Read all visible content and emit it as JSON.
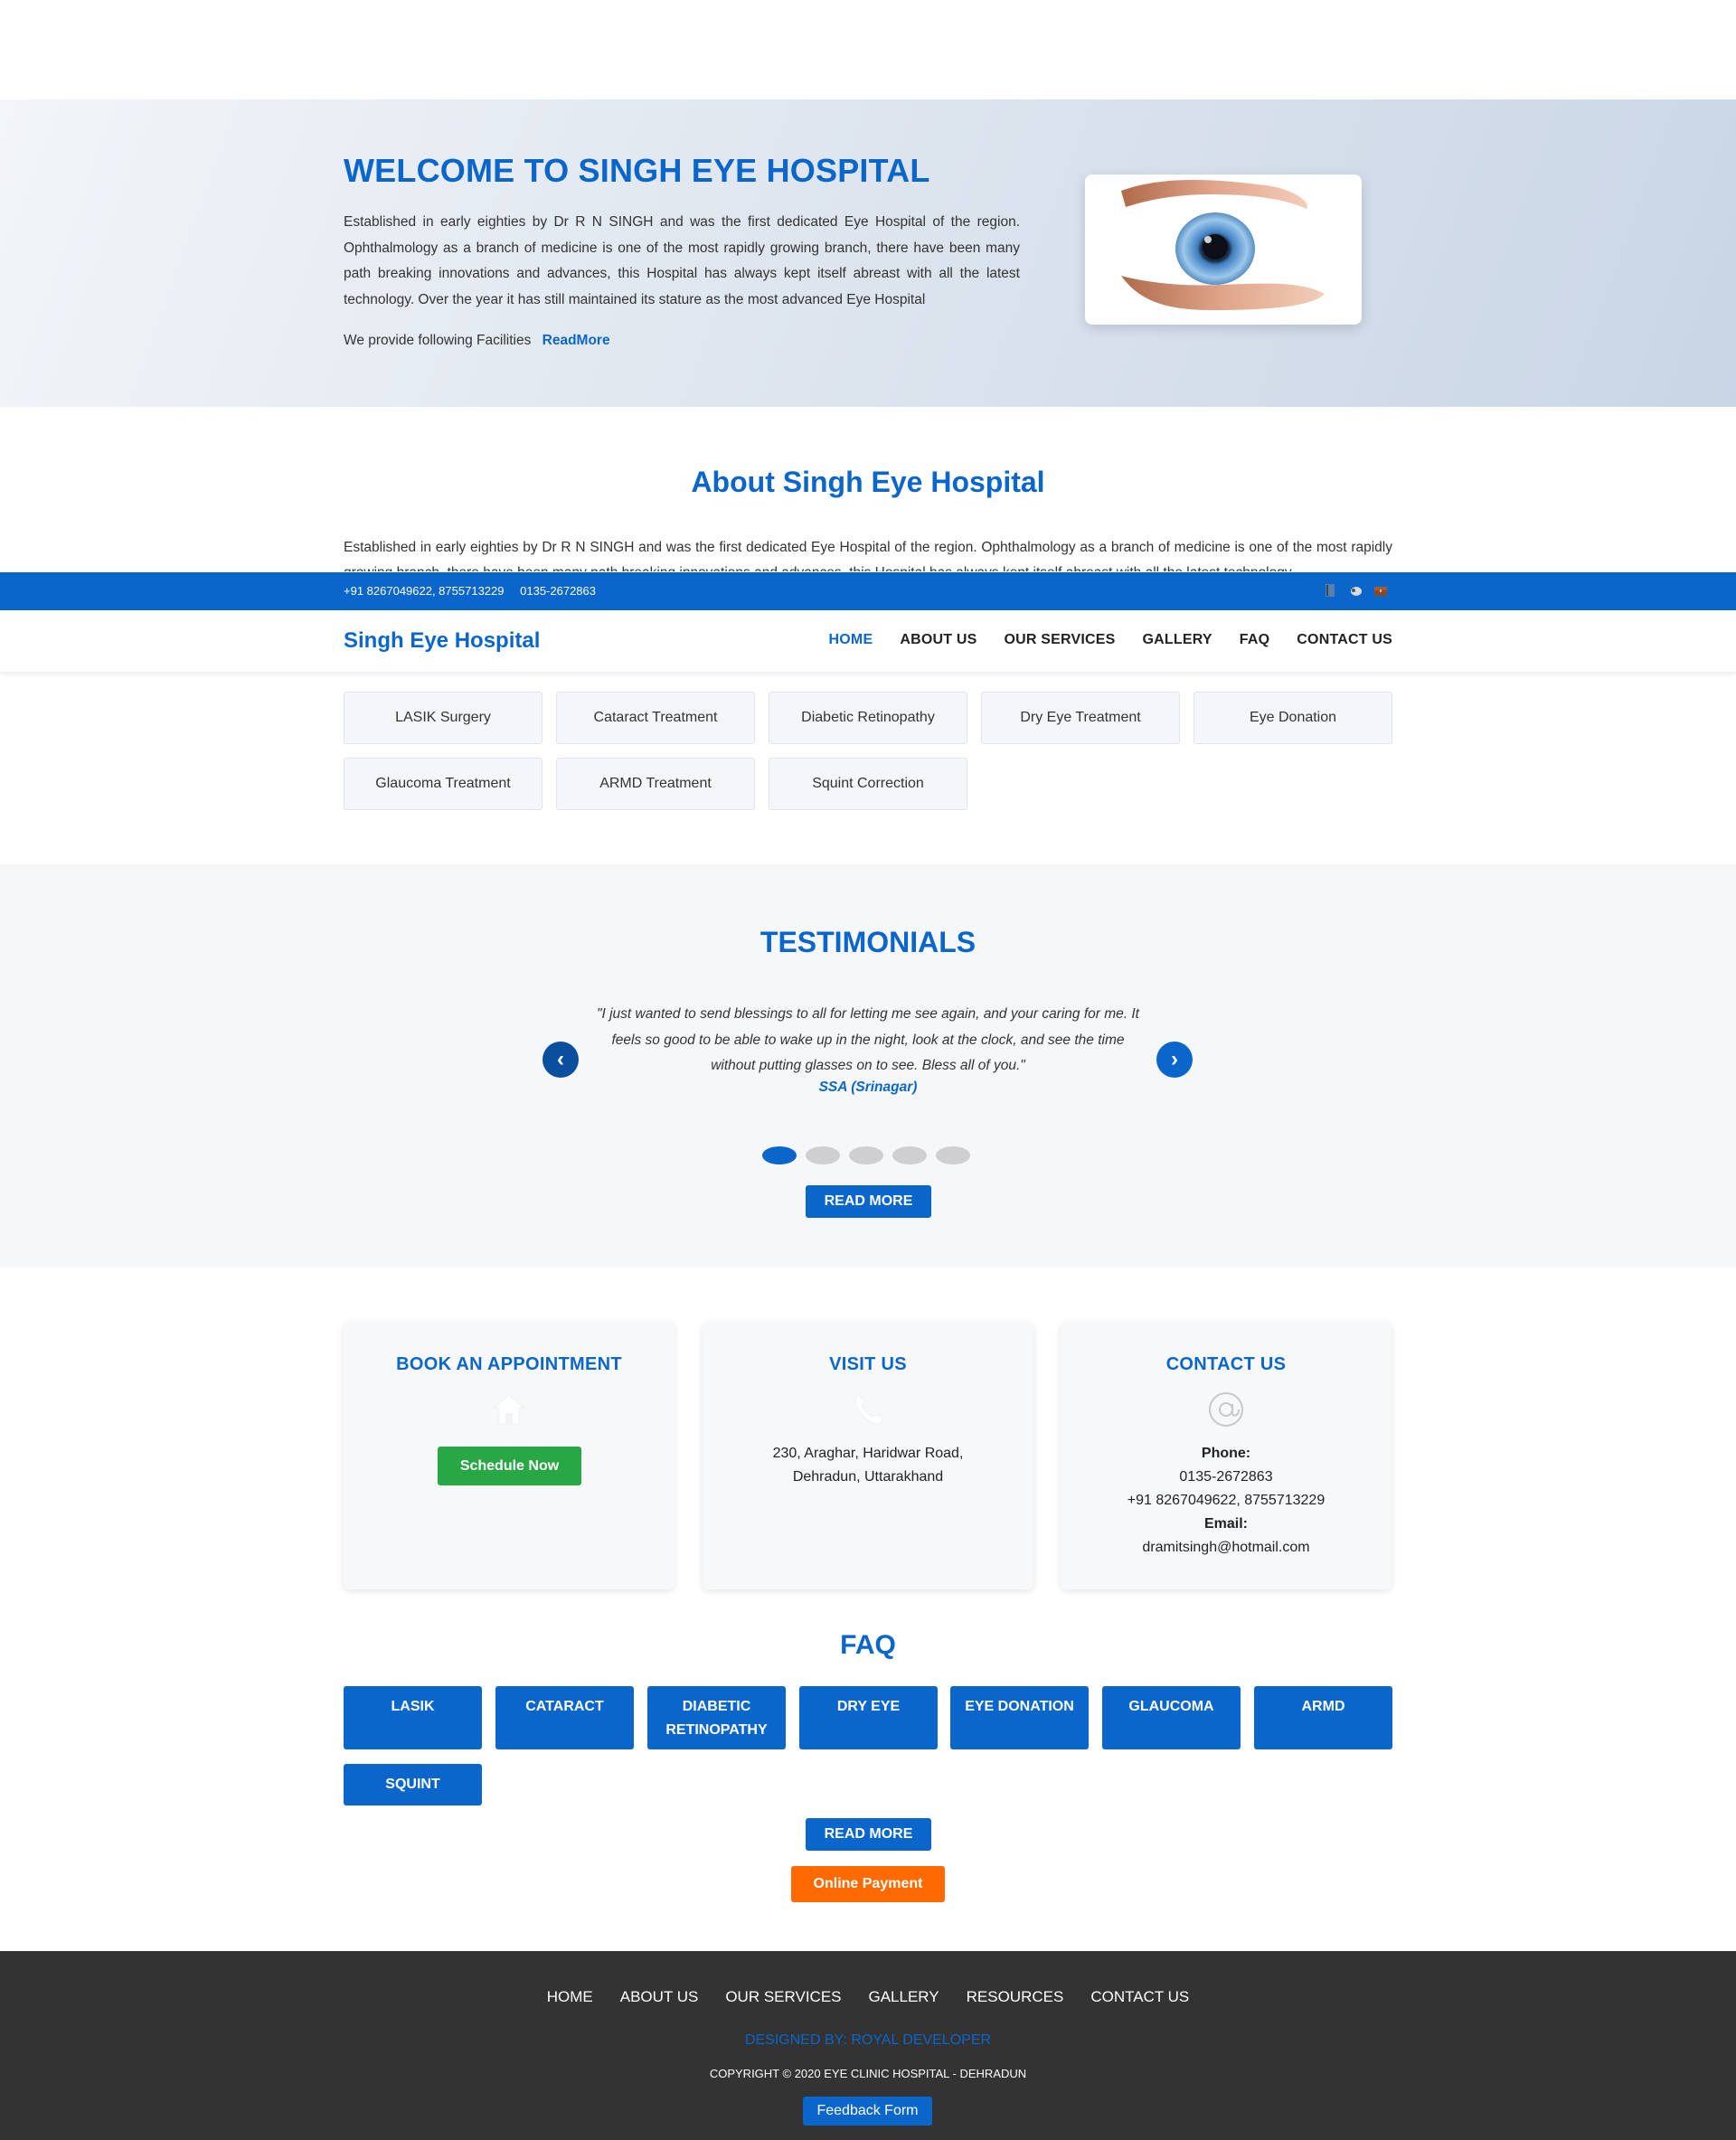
{
  "hero": {
    "title": "WELCOME TO SINGH EYE HOSPITAL",
    "paragraph": "Established in early eighties by Dr R N SINGH and was the first dedicated Eye Hospital of the region. Ophthalmology as a branch of medicine is one of the most rapidly growing branch, there have been many path breaking innovations and advances, this Hospital has always kept itself abreast with all the latest technology. Over the year it has still maintained its stature as the most advanced Eye Hospital",
    "facilities_text": "We provide following Facilities",
    "read_more": "ReadMore",
    "image_icon": "eye-in-hands-image"
  },
  "about": {
    "title": "About Singh Eye Hospital",
    "paragraph": "Established in early eighties by Dr R N SINGH and was the first dedicated Eye Hospital of the region. Ophthalmology as a branch of medicine is one of the most rapidly growing branch, there have been many path breaking innovations and advances, this Hospital has always kept itself abreast with all the latest technology."
  },
  "topbar": {
    "mobile": "+91 8267049622, 8755713229",
    "landline": "0135-2672863",
    "icons": [
      "book-icon",
      "mouse-icon",
      "chest-icon"
    ]
  },
  "nav": {
    "brand": "Singh Eye Hospital",
    "items": [
      {
        "label": "HOME",
        "active": true
      },
      {
        "label": "ABOUT US"
      },
      {
        "label": "OUR SERVICES"
      },
      {
        "label": "GALLERY"
      },
      {
        "label": "FAQ"
      },
      {
        "label": "CONTACT US"
      }
    ]
  },
  "services": [
    "LASIK Surgery",
    "Cataract Treatment",
    "Diabetic Retinopathy",
    "Dry Eye Treatment",
    "Eye Donation",
    "Glaucoma Treatment",
    "ARMD Treatment",
    "Squint Correction"
  ],
  "testimonials": {
    "title": "TESTIMONIALS",
    "quote": "\"I just wanted to send blessings to all for letting me see again, and your caring for me. It feels so good to be able to wake up in the night, look at the clock, and see the time without putting glasses on to see. Bless all of you.\"",
    "author": "SSA (Srinagar)",
    "prev": "‹",
    "next": "›",
    "active_slide": 1,
    "slide_count": 5,
    "read_more": "READ MORE"
  },
  "cards": {
    "appointment": {
      "title": "BOOK AN APPOINTMENT",
      "icon": "home-icon",
      "button": "Schedule Now"
    },
    "visit": {
      "title": "VISIT US",
      "icon": "phone-icon",
      "address_line1": "230, Araghar, Haridwar Road,",
      "address_line2": "Dehradun, Uttarakhand"
    },
    "contact": {
      "title": "CONTACT US",
      "icon": "at-icon",
      "phone_label": "Phone:",
      "phone1": "0135-2672863",
      "phone2": "+91 8267049622, 8755713229",
      "email_label": "Email:",
      "email": "dramitsingh@hotmail.com"
    }
  },
  "faq": {
    "title": "FAQ",
    "items": [
      "LASIK",
      "CATARACT",
      "DIABETIC RETINOPATHY",
      "DRY EYE",
      "EYE DONATION",
      "GLAUCOMA",
      "ARMD",
      "SQUINT"
    ],
    "read_more": "READ MORE",
    "payment": "Online Payment"
  },
  "footer": {
    "menu": [
      "HOME",
      "ABOUT US",
      "OUR SERVICES",
      "GALLERY",
      "RESOURCES",
      "CONTACT US"
    ],
    "designed_by": "DESIGNED BY: ROYAL DEVELOPER",
    "copyright": "COPYRIGHT © 2020 EYE CLINIC HOSPITAL - DEHRADUN",
    "feedback": "Feedback Form"
  },
  "colors": {
    "primary": "#0b66cc",
    "success": "#28a745",
    "payment": "#ff6a00",
    "footer": "#333333"
  }
}
